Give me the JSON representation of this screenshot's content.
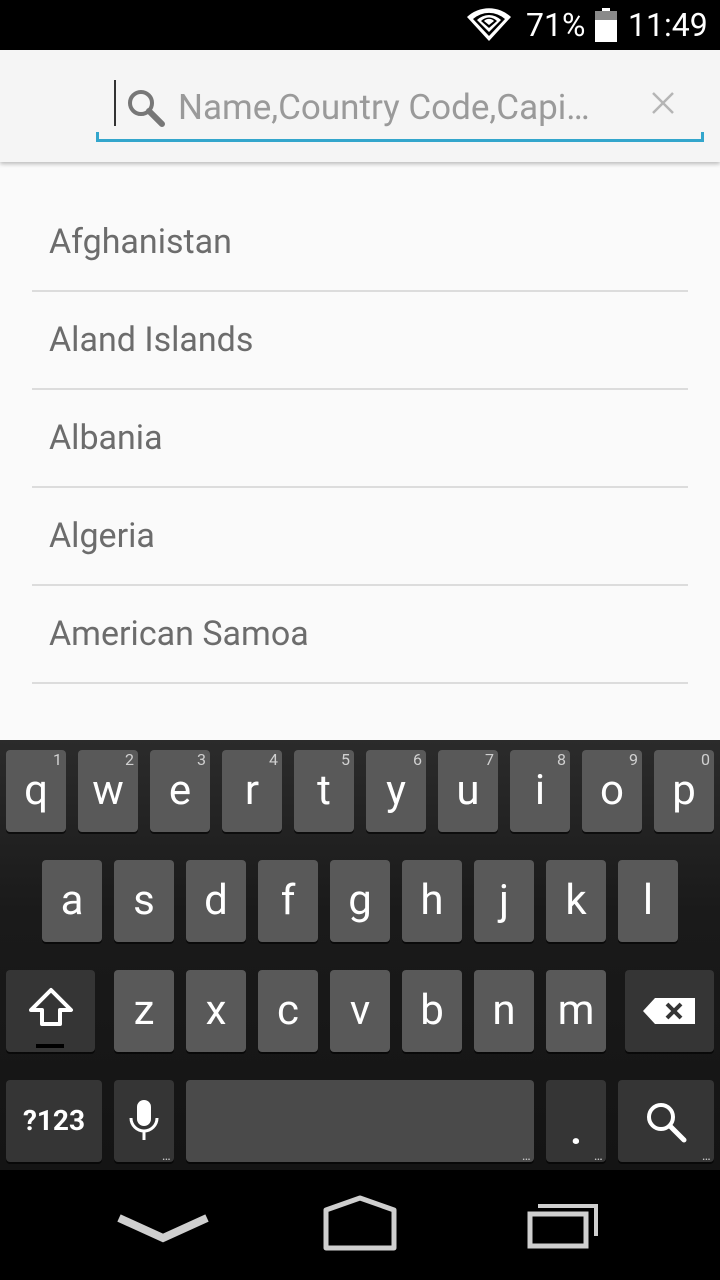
{
  "status_bar": {
    "battery_percent": "71%",
    "time": "11:49",
    "icons": [
      "wifi-icon",
      "battery-icon"
    ]
  },
  "search": {
    "placeholder": "Name,Country Code,Capi…",
    "value": "",
    "icons": [
      "search-icon",
      "clear-icon"
    ],
    "accent_color": "#33a6cc"
  },
  "countries": [
    "Afghanistan",
    "Aland Islands",
    "Albania",
    "Algeria",
    "American Samoa"
  ],
  "keyboard": {
    "row1": [
      {
        "label": "q",
        "hint": "1"
      },
      {
        "label": "w",
        "hint": "2"
      },
      {
        "label": "e",
        "hint": "3"
      },
      {
        "label": "r",
        "hint": "4"
      },
      {
        "label": "t",
        "hint": "5"
      },
      {
        "label": "y",
        "hint": "6"
      },
      {
        "label": "u",
        "hint": "7"
      },
      {
        "label": "i",
        "hint": "8"
      },
      {
        "label": "o",
        "hint": "9"
      },
      {
        "label": "p",
        "hint": "0"
      }
    ],
    "row2": [
      "a",
      "s",
      "d",
      "f",
      "g",
      "h",
      "j",
      "k",
      "l"
    ],
    "row3": [
      "z",
      "x",
      "c",
      "v",
      "b",
      "n",
      "m"
    ],
    "symbols_label": "?123",
    "period_label": ".",
    "more_indicator": "...",
    "icons": [
      "shift-icon",
      "backspace-icon",
      "microphone-icon",
      "search-icon"
    ]
  },
  "nav_bar": {
    "icons": [
      "back-icon",
      "home-icon",
      "recent-apps-icon"
    ]
  }
}
